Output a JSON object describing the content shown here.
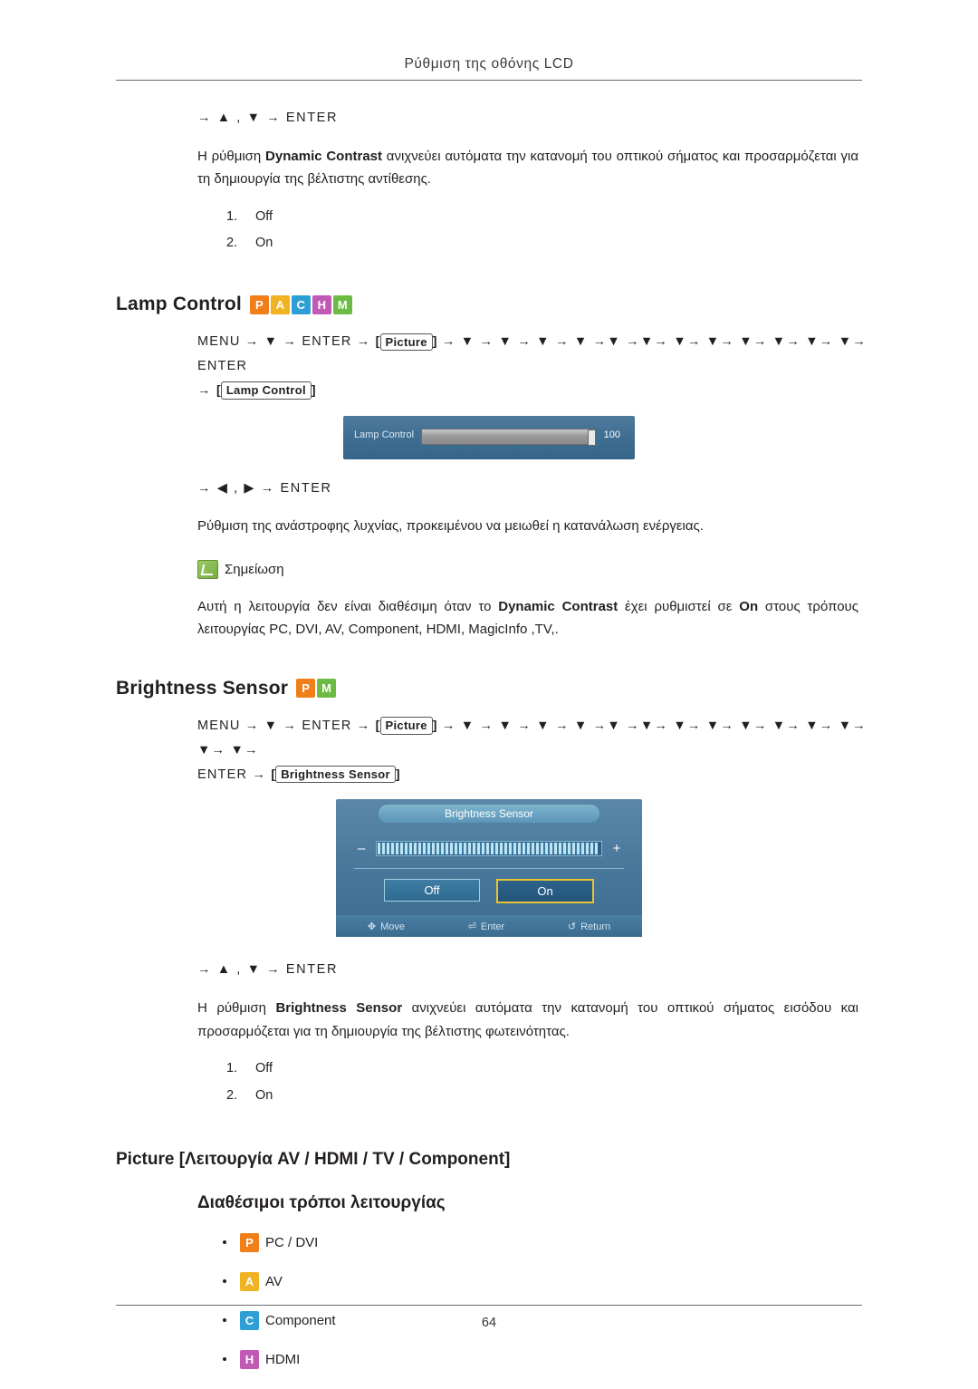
{
  "header": {
    "title": "Ρύθμιση της οθόνης LCD"
  },
  "footer": {
    "page_number": "64"
  },
  "dynamic_contrast": {
    "navline": "→ ▲ , ▼ → ENTER",
    "paragraph_pre": "Η ρύθμιση ",
    "paragraph_bold": "Dynamic Contrast",
    "paragraph_post": " ανιχνεύει αυτόματα την κατανομή του οπτικού σήματος και προσαρμόζεται για τη δημιουργία της βέλτιστης αντίθεσης.",
    "options": [
      {
        "num": "1.",
        "label": "Off"
      },
      {
        "num": "2.",
        "label": "On"
      }
    ]
  },
  "lamp_control": {
    "heading": "Lamp Control",
    "badges": [
      "P",
      "A",
      "C",
      "H",
      "M"
    ],
    "menu_path_1": "MENU → ▼ → ENTER →",
    "menu_pill_1": "Picture",
    "menu_path_2": "→ ▼ → ▼ → ▼ → ▼ →▼ →▼→ ▼→ ▼→ ▼→ ▼→ ▼→ ▼→ ENTER",
    "menu_path_3": "→",
    "menu_pill_2": "Lamp Control",
    "osd": {
      "label": "Lamp Control",
      "value": "100"
    },
    "navline": "→ ◀ , ▶ → ENTER",
    "paragraph": "Ρύθμιση της ανάστροφης λυχνίας, προκειμένου να μειωθεί η κατανάλωση ενέργειας.",
    "note_label": "Σημείωση",
    "note_pre": "Αυτή η λειτουργία δεν είναι διαθέσιμη όταν το ",
    "note_bold1": "Dynamic Contrast",
    "note_mid": " έχει ρυθμιστεί σε ",
    "note_bold2": "On",
    "note_post": " στους τρόπους λειτουργίας PC, DVI, AV, Component, HDMI, MagicInfo ,TV,."
  },
  "brightness_sensor": {
    "heading": "Brightness Sensor",
    "badges": [
      "P",
      "M"
    ],
    "menu_path_1": "MENU → ▼ → ENTER →",
    "menu_pill_1": "Picture",
    "menu_path_2": "→ ▼ → ▼ → ▼ → ▼ →▼ →▼→ ▼→ ▼→ ▼→ ▼→ ▼→ ▼→ ▼→ ▼→",
    "menu_path_3": "ENTER →",
    "menu_pill_2": "Brightness Sensor",
    "osd": {
      "title": "Brightness Sensor",
      "minus": "–",
      "plus": "+",
      "button_off": "Off",
      "button_on": "On",
      "footer_move": "Move",
      "footer_enter": "Enter",
      "footer_return": "Return"
    },
    "navline": "→ ▲ , ▼ → ENTER",
    "paragraph_pre": "Η ρύθμιση ",
    "paragraph_bold": "Brightness Sensor",
    "paragraph_post": " ανιχνεύει αυτόματα την κατανομή του οπτικού σήματος εισόδου και προσαρμόζεται για τη δημιουργία της βέλτιστης φωτεινότητας.",
    "options": [
      {
        "num": "1.",
        "label": "Off"
      },
      {
        "num": "2.",
        "label": "On"
      }
    ]
  },
  "picture_section": {
    "heading": "Picture [Λειτουργία AV / HDMI / TV / Component]",
    "subheading": "Διαθέσιμοι τρόποι λειτουργίας",
    "items": [
      {
        "badge": "P",
        "badge_class": "p",
        "label": "PC / DVI"
      },
      {
        "badge": "A",
        "badge_class": "a",
        "label": "AV"
      },
      {
        "badge": "C",
        "badge_class": "c",
        "label": "Component"
      },
      {
        "badge": "H",
        "badge_class": "h",
        "label": "HDMI"
      }
    ]
  }
}
